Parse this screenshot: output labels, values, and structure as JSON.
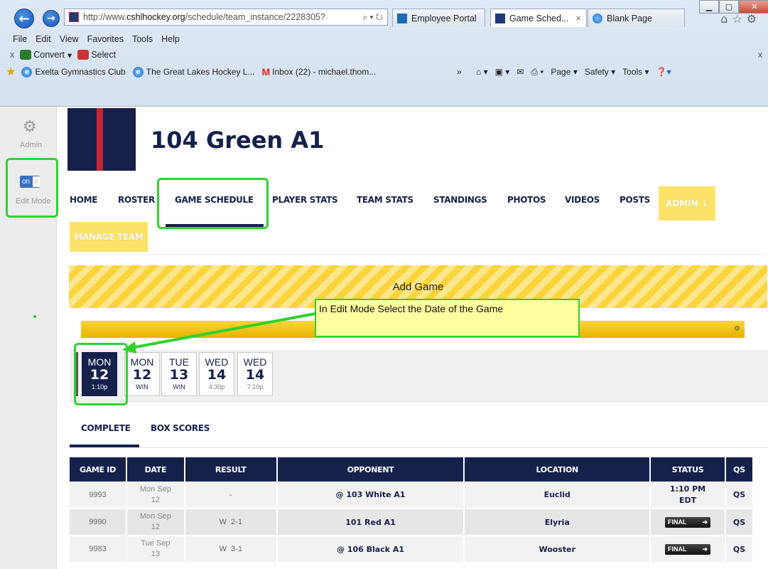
{
  "browser": {
    "url_base": "http://www.",
    "url_host": "cshlhockey.org",
    "url_path": "/schedule/team_instance/2228305?",
    "addr_icons": "⌕ ▾ ↻",
    "tabs": [
      {
        "label": "Employee Portal"
      },
      {
        "label": "Game Sched...",
        "close": "×"
      },
      {
        "label": "Blank Page"
      }
    ],
    "menu": [
      "File",
      "Edit",
      "View",
      "Favorites",
      "Tools",
      "Help"
    ],
    "cmd": {
      "close": "x",
      "convert": "Convert",
      "select": "Select",
      "close_right": "x"
    },
    "favorites": [
      {
        "label": "Exelta Gymnastics Club"
      },
      {
        "label": "The Great Lakes Hockey L..."
      },
      {
        "label": "Inbox (22) - michael.thom..."
      }
    ],
    "fav_more": "»",
    "commands": [
      "Page ▾",
      "Safety ▾",
      "Tools ▾"
    ],
    "right_icons": "⌂☆⚙"
  },
  "sidebar": {
    "admin_label": "Admin",
    "toggle_on": "on",
    "toggle_knob": "II",
    "edit_mode_label": "Edit Mode"
  },
  "team": {
    "title": "104 Green A1"
  },
  "nav": {
    "items": [
      "HOME",
      "ROSTER",
      "GAME SCHEDULE",
      "PLAYER STATS",
      "TEAM STATS",
      "STANDINGS",
      "PHOTOS",
      "VIDEOS",
      "POSTS"
    ],
    "admin": "ADMIN ↓",
    "manage": "MANAGE TEAM"
  },
  "add_game": "Add Game",
  "callout": "In Edit Mode Select the Date of the Game",
  "dates": [
    {
      "dow": "MON",
      "day": "12",
      "res": "1:10p",
      "selected": true
    },
    {
      "dow": "MON",
      "day": "12",
      "res": "WIN"
    },
    {
      "dow": "TUE",
      "day": "13",
      "res": "WIN"
    },
    {
      "dow": "WED",
      "day": "14",
      "res": "4:30p"
    },
    {
      "dow": "WED",
      "day": "14",
      "res": "7:10p"
    }
  ],
  "subtabs": [
    "COMPLETE",
    "BOX SCORES"
  ],
  "table": {
    "headers": [
      "GAME ID",
      "DATE",
      "RESULT",
      "OPPONENT",
      "LOCATION",
      "STATUS",
      "QS"
    ],
    "rows": [
      {
        "id": "9993",
        "date1": "Mon Sep",
        "date2": "12",
        "result": "-",
        "opponent": "@ 103 White A1",
        "location": "Euclid",
        "status1": "1:10 PM",
        "status2": "EDT",
        "qs": "QS"
      },
      {
        "id": "9990",
        "date1": "Mon Sep",
        "date2": "12",
        "result": "W  2-1",
        "opponent": "101 Red A1",
        "location": "Elyria",
        "final": "FINAL",
        "qs": "QS"
      },
      {
        "id": "9983",
        "date1": "Tue Sep",
        "date2": "13",
        "result": "W  3-1",
        "opponent": "@ 106 Black A1",
        "location": "Wooster",
        "final": "FINAL",
        "qs": "QS"
      }
    ]
  },
  "colors": {
    "navy": "#15214b",
    "highlight": "#2fd22f",
    "gold": "#fbd33a"
  }
}
